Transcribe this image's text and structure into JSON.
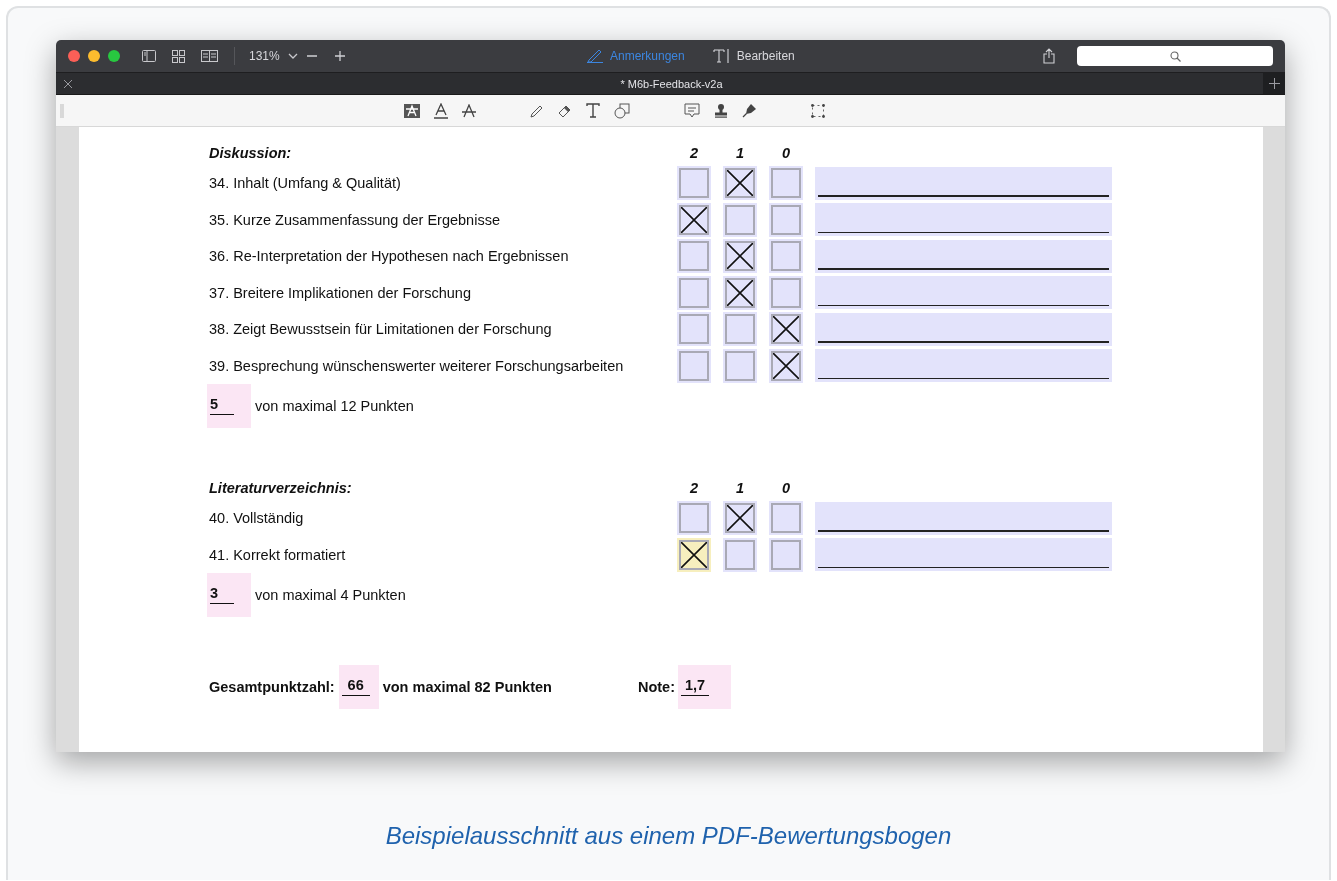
{
  "window": {
    "zoom": "131%",
    "mode_tabs": [
      {
        "label": "Anmerkungen",
        "selected": true
      },
      {
        "label": "Bearbeiten",
        "selected": false
      }
    ],
    "document_tab": "* M6b-Feedback-v2a"
  },
  "form": {
    "sections": [
      {
        "title": "Diskussion:",
        "score_headers": [
          "2",
          "1",
          "0"
        ],
        "criteria": [
          {
            "label": "34. Inhalt (Umfang & Qualität)",
            "boxes": [
              {
                "checked": false,
                "color": "#e3e3fb"
              },
              {
                "checked": true,
                "color": "#e3e3fb"
              },
              {
                "checked": false,
                "color": "#e3e3fb"
              }
            ]
          },
          {
            "label": "35. Kurze Zusammenfassung der Ergebnisse",
            "boxes": [
              {
                "checked": true,
                "color": "#e3e3fb"
              },
              {
                "checked": false,
                "color": "#e3e3fb"
              },
              {
                "checked": false,
                "color": "#e3e3fb"
              }
            ]
          },
          {
            "label": "36. Re-Interpretation der Hypothesen nach Ergebnissen",
            "boxes": [
              {
                "checked": false,
                "color": "#e3e3fb"
              },
              {
                "checked": true,
                "color": "#e3e3fb"
              },
              {
                "checked": false,
                "color": "#e3e3fb"
              }
            ]
          },
          {
            "label": "37. Breitere Implikationen der Forschung",
            "boxes": [
              {
                "checked": false,
                "color": "#e3e3fb"
              },
              {
                "checked": true,
                "color": "#e3e3fb"
              },
              {
                "checked": false,
                "color": "#e3e3fb"
              }
            ]
          },
          {
            "label": "38. Zeigt Bewusstsein für Limitationen der Forschung",
            "boxes": [
              {
                "checked": false,
                "color": "#e3e3fb"
              },
              {
                "checked": false,
                "color": "#e3e3fb"
              },
              {
                "checked": true,
                "color": "#e3e3fb"
              }
            ]
          },
          {
            "label": "39. Besprechung wünschenswerter weiterer Forschungsarbeiten",
            "boxes": [
              {
                "checked": false,
                "color": "#e3e3fb"
              },
              {
                "checked": false,
                "color": "#e3e3fb"
              },
              {
                "checked": true,
                "color": "#e3e3fb"
              }
            ]
          }
        ],
        "points": "5",
        "points_text": "von maximal 12 Punkten"
      },
      {
        "title": "Literaturverzeichnis:",
        "score_headers": [
          "2",
          "1",
          "0"
        ],
        "criteria": [
          {
            "label": "40. Vollständig",
            "boxes": [
              {
                "checked": false,
                "color": "#e3e3fb"
              },
              {
                "checked": true,
                "color": "#e3e3fb"
              },
              {
                "checked": false,
                "color": "#e3e3fb"
              }
            ]
          },
          {
            "label": "41. Korrekt formatiert",
            "boxes": [
              {
                "checked": true,
                "color": "#f7efbe"
              },
              {
                "checked": false,
                "color": "#e3e3fb"
              },
              {
                "checked": false,
                "color": "#e3e3fb"
              }
            ]
          }
        ],
        "points": "3",
        "points_text": "von maximal 4 Punkten"
      }
    ],
    "total": {
      "label": "Gesamtpunktzahl:",
      "value": "66",
      "text": "von maximal 82 Punkten"
    },
    "grade": {
      "label": "Note:",
      "value": "1,7"
    }
  },
  "caption": "Beispielausschnitt aus einem PDF-Bewertungsbogen"
}
